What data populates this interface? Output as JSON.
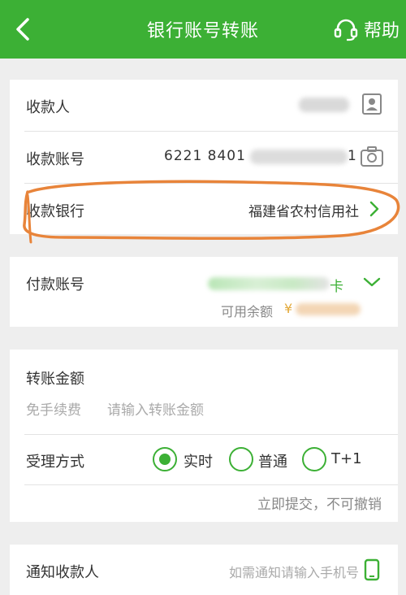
{
  "header": {
    "title": "银行账号转账",
    "help_label": "帮助"
  },
  "recipient": {
    "payee_label": "收款人",
    "payee_value": "",
    "account_label": "收款账号",
    "account_value": "6221 8401",
    "account_tail": "1",
    "bank_label": "收款银行",
    "bank_value": "福建省农村信用社"
  },
  "payment": {
    "account_label": "付款账号",
    "account_suffix": "卡",
    "balance_label": "可用余额",
    "currency_symbol": "¥"
  },
  "amount": {
    "label": "转账金额",
    "fee_note": "免手续费",
    "placeholder": "请输入转账金额",
    "method_label": "受理方式",
    "options": [
      "实时",
      "普通",
      "T+1"
    ],
    "selected_index": 0,
    "method_note": "立即提交，不可撤销"
  },
  "notify": {
    "label": "通知收款人",
    "placeholder": "如需通知请输入手机号"
  },
  "colors": {
    "brand_green": "#3cb035",
    "annotation_orange": "#e8843a"
  }
}
